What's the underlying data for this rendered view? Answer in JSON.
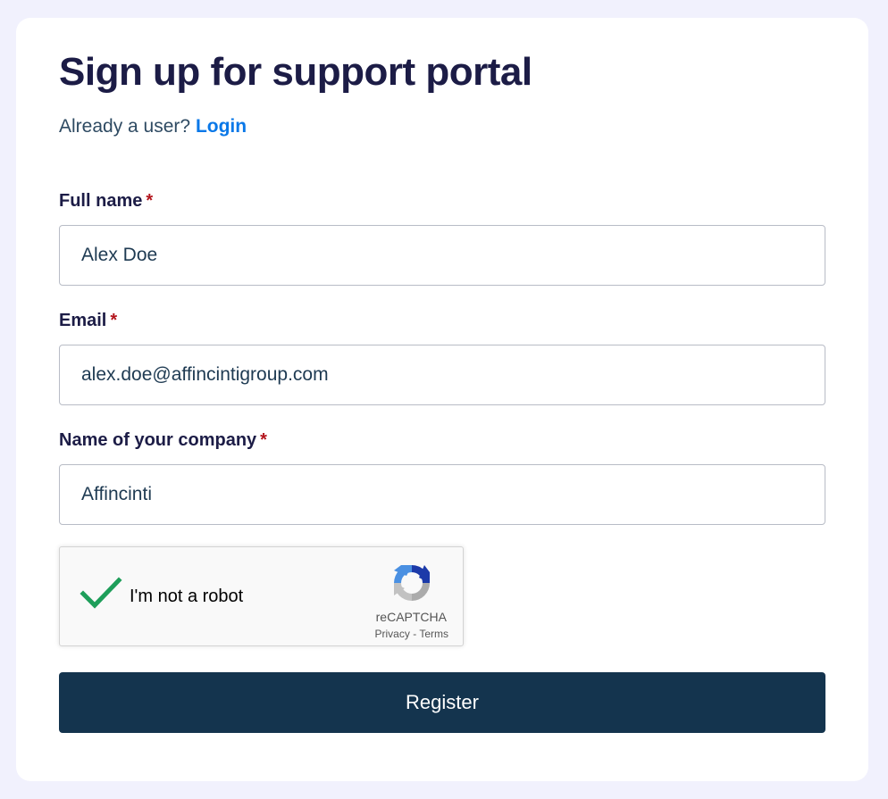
{
  "header": {
    "title": "Sign up for support portal",
    "subtitle_prefix": "Already a user?",
    "login_link": "Login"
  },
  "form": {
    "full_name": {
      "label": "Full name",
      "required_mark": "*",
      "value": "Alex Doe"
    },
    "email": {
      "label": "Email",
      "required_mark": "*",
      "value": "alex.doe@affincintigroup.com"
    },
    "company": {
      "label": "Name of your company",
      "required_mark": "*",
      "value": "Affincinti"
    }
  },
  "captcha": {
    "label": "I'm not a robot",
    "checked": true,
    "brand": "reCAPTCHA",
    "privacy": "Privacy",
    "separator": "-",
    "terms": "Terms",
    "check_icon": "checkmark-icon",
    "logo_icon": "recaptcha-logo-icon"
  },
  "actions": {
    "register_label": "Register"
  },
  "colors": {
    "page_background": "#f1f1fd",
    "card_background": "#ffffff",
    "heading": "#1c1c46",
    "link": "#0a78e8",
    "required": "#b3141c",
    "button": "#14344e",
    "check": "#1e9e5a"
  }
}
